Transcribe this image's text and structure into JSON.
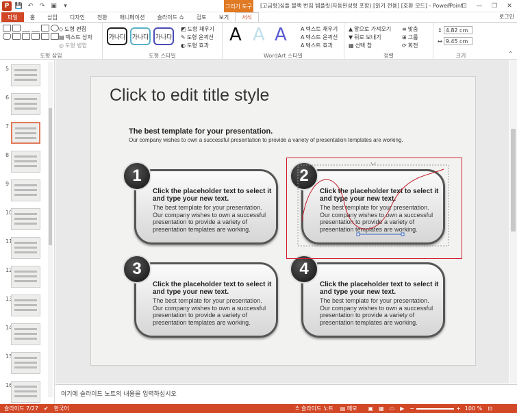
{
  "titlebar": {
    "app_icon_letter": "P",
    "context_tab": "그리기 도구",
    "doc_title": "[고급형]심플 블랙 번짐 템플릿(자동완성형 포함) [읽기 전용] [호환 모드] - PowerPoint",
    "help": "?",
    "minimize": "—",
    "restore": "❐",
    "close": "✕",
    "qat": [
      "save-icon",
      "undo-icon",
      "redo-icon",
      "start-icon",
      "customize-icon"
    ]
  },
  "tabs": [
    "파일",
    "홈",
    "삽입",
    "디자인",
    "전환",
    "애니메이션",
    "슬라이드 쇼",
    "검토",
    "보기",
    "서식"
  ],
  "login": "로그인",
  "ribbon": {
    "insert_shapes": {
      "edit_shape": "도형 편집",
      "text_box": "텍스트 상자",
      "merge_shapes": "도형 병합",
      "label": "도형 삽입"
    },
    "shape_styles": {
      "samples": [
        "가나다",
        "가나다",
        "가나다"
      ],
      "fill": "도형 채우기",
      "outline": "도형 윤곽선",
      "effects": "도형 효과",
      "label": "도형 스타일"
    },
    "wordart": {
      "samples": [
        "A",
        "A",
        "A"
      ],
      "text_fill": "텍스트 채우기",
      "text_outline": "텍스트 윤곽선",
      "text_effects": "텍스트 효과",
      "label": "WordArt 스타일"
    },
    "arrange": {
      "bring_forward": "앞으로 가져오기",
      "send_backward": "뒤로 보내기",
      "selection_pane": "선택 창",
      "align": "맞춤",
      "group": "그룹",
      "rotate": "회전",
      "label": "정렬"
    },
    "size": {
      "height": "4.82 cm",
      "width": "9.45 cm",
      "label": "크기"
    }
  },
  "thumbnails": [
    {
      "num": "5"
    },
    {
      "num": "6"
    },
    {
      "num": "7",
      "selected": true
    },
    {
      "num": "8"
    },
    {
      "num": "9"
    },
    {
      "num": "10"
    },
    {
      "num": "11"
    },
    {
      "num": "12"
    },
    {
      "num": "13"
    },
    {
      "num": "14"
    },
    {
      "num": "15"
    },
    {
      "num": "16"
    }
  ],
  "slide": {
    "title": "Click to edit title style",
    "subhead": "The best template for your presentation.",
    "subtext": "Our company wishes to own a successful presentation to provide a variety of presentation templates are working.",
    "cards": [
      {
        "num": "1",
        "heading": "Click the placeholder text to select it and type your new text.",
        "body": "The best template for your presentation. Our company wishes to own a successful presentation to provide a variety of presentation templates are working."
      },
      {
        "num": "2",
        "heading": "Click the placeholder text to select it and type your new text.",
        "body": "The best template for your presentation. Our company wishes to own a successful presentation to provide a variety of presentation templates are working."
      },
      {
        "num": "3",
        "heading": "Click the placeholder text to select it and type your new text.",
        "body": "The best template for your presentation. Our company wishes to own a successful presentation to provide a variety of presentation templates are working."
      },
      {
        "num": "4",
        "heading": "Click the placeholder text to select it and type your new text.",
        "body": "The best template for your presentation. Our company wishes to own a successful presentation to provide a variety of presentation templates are working."
      }
    ]
  },
  "notes_placeholder": "여기에 슬라이드 노트의 내용을 입력하십시오",
  "status": {
    "slide_info": "슬라이드 7/27",
    "language": "한국어",
    "notes_btn": "슬라이드 노트",
    "comments_btn": "메모",
    "zoom": "100 %"
  },
  "colors": {
    "accent": "#d24726",
    "context": "#e07a24",
    "selection": "#d02030"
  }
}
